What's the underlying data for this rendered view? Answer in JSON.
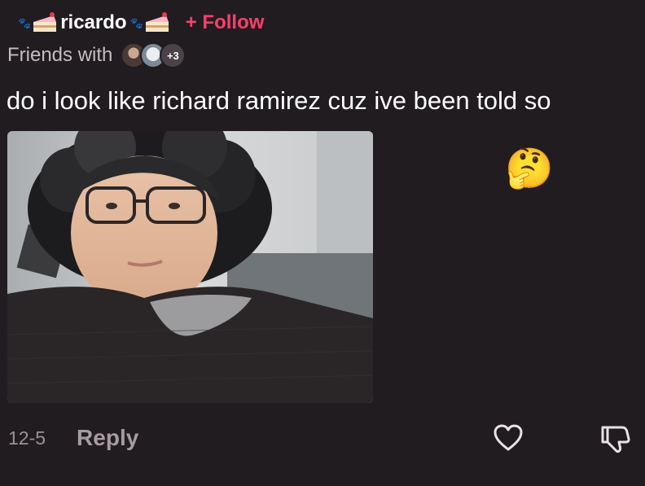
{
  "comment": {
    "username": "ricardo",
    "follow_label": "+ Follow",
    "friends_label": "Friends with",
    "friends_more": "+3",
    "text": "do i look like richard ramirez cuz ive been told so",
    "emoji": "🤔",
    "date": "12-5",
    "reply_label": "Reply"
  },
  "icons": {
    "badge_left": "cake-icon",
    "badge_right": "cake-icon",
    "decor": "paw-icon",
    "like": "heart-outline-icon",
    "dislike": "thumbs-down-outline-icon"
  },
  "colors": {
    "background": "#211c20",
    "follow": "#fd3f6b",
    "secondary_text": "#c4bcc0",
    "meta_text": "#9a9196"
  }
}
